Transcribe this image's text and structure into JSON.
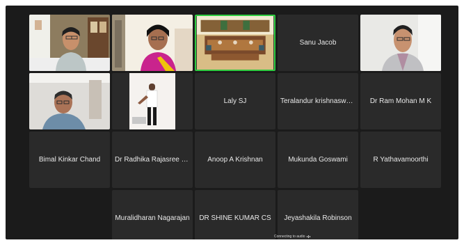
{
  "meeting": {
    "participants": [
      {
        "id": "video-1",
        "name": "",
        "has_video": true
      },
      {
        "id": "video-2",
        "name": "",
        "has_video": true
      },
      {
        "id": "video-3",
        "name": "",
        "has_video": true,
        "active_speaker": true
      },
      {
        "id": "sanu-jacob",
        "name": "Sanu Jacob",
        "has_video": false
      },
      {
        "id": "video-5",
        "name": "",
        "has_video": true
      },
      {
        "id": "video-6",
        "name": "",
        "has_video": true
      },
      {
        "id": "video-7",
        "name": "",
        "has_video": true
      },
      {
        "id": "laly-sj",
        "name": "Laly SJ",
        "has_video": false
      },
      {
        "id": "teralandur",
        "name": "Teralandur krishnaswam...",
        "has_video": false
      },
      {
        "id": "ram-mohan",
        "name": "Dr Ram Mohan M K",
        "has_video": false
      },
      {
        "id": "bimal",
        "name": "Bimal Kinkar Chand",
        "has_video": false
      },
      {
        "id": "radhika",
        "name": "Dr Radhika Rajasree S.R.",
        "has_video": false
      },
      {
        "id": "anoop",
        "name": "Anoop A Krishnan",
        "has_video": false
      },
      {
        "id": "mukunda",
        "name": "Mukunda Goswami",
        "has_video": false
      },
      {
        "id": "yathavamoorthi",
        "name": "R Yathavamoorthi",
        "has_video": false
      },
      {
        "id": "muralidharan",
        "name": "Muralidharan Nagarajan",
        "has_video": false
      },
      {
        "id": "shine-kumar",
        "name": "DR SHINE KUMAR CS",
        "has_video": false
      },
      {
        "id": "jeyashakila",
        "name": "Jeyashakila Robinson",
        "has_video": false
      }
    ],
    "status_text": "Connecting to audio",
    "active_speaker_color": "#2ecc40",
    "tile_color": "#2a2a2a",
    "background_color": "#1b1b1b"
  }
}
